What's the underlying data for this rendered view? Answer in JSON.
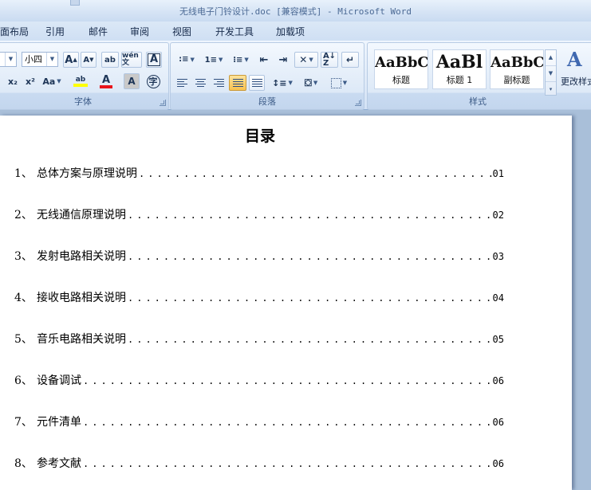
{
  "window": {
    "title": "无线电子门铃设计.doc [兼容模式] - Microsoft Word"
  },
  "tabs": [
    "页面布局",
    "引用",
    "邮件",
    "审阅",
    "视图",
    "开发工具",
    "加载项"
  ],
  "font_group": {
    "label": "字体",
    "font_size": "小四",
    "grow_font": "A",
    "shrink_font": "A",
    "clear_format": "ab",
    "phonetic": "wén 文",
    "char_border": "A",
    "subscript": "x₂",
    "superscript": "x²",
    "change_case": "Aa",
    "highlight": "ab",
    "font_color": "A",
    "char_shading": "A",
    "enclose_char": "字"
  },
  "paragraph_group": {
    "label": "段落"
  },
  "styles_group": {
    "label": "样式",
    "styles": [
      {
        "preview": "AaBbC",
        "name": "标题"
      },
      {
        "preview": "AaBl",
        "name": "标题 1"
      },
      {
        "preview": "AaBbC",
        "name": "副标题"
      }
    ],
    "change_styles": "更改样式"
  },
  "document": {
    "title": "目录",
    "toc": [
      {
        "num": "1、",
        "text": "总体方案与原理说明",
        "page": "01"
      },
      {
        "num": "2、",
        "text": "无线通信原理说明",
        "page": "02"
      },
      {
        "num": "3、",
        "text": "发射电路相关说明",
        "page": "03"
      },
      {
        "num": "4、",
        "text": "接收电路相关说明",
        "page": "04"
      },
      {
        "num": "5、",
        "text": "音乐电路相关说明",
        "page": "05"
      },
      {
        "num": "6、",
        "text": "设备调试",
        "page": "06"
      },
      {
        "num": "7、",
        "text": "元件清单",
        "page": "06"
      },
      {
        "num": "8、",
        "text": "参考文献",
        "page": "06"
      }
    ]
  },
  "colors": {
    "ribbon": "#dfeaf8",
    "doc_bg": "#a9bfd9",
    "font_color_bar": "#e8141b",
    "highlight_bar": "#ffff00",
    "group_label": "#3b5a86"
  }
}
